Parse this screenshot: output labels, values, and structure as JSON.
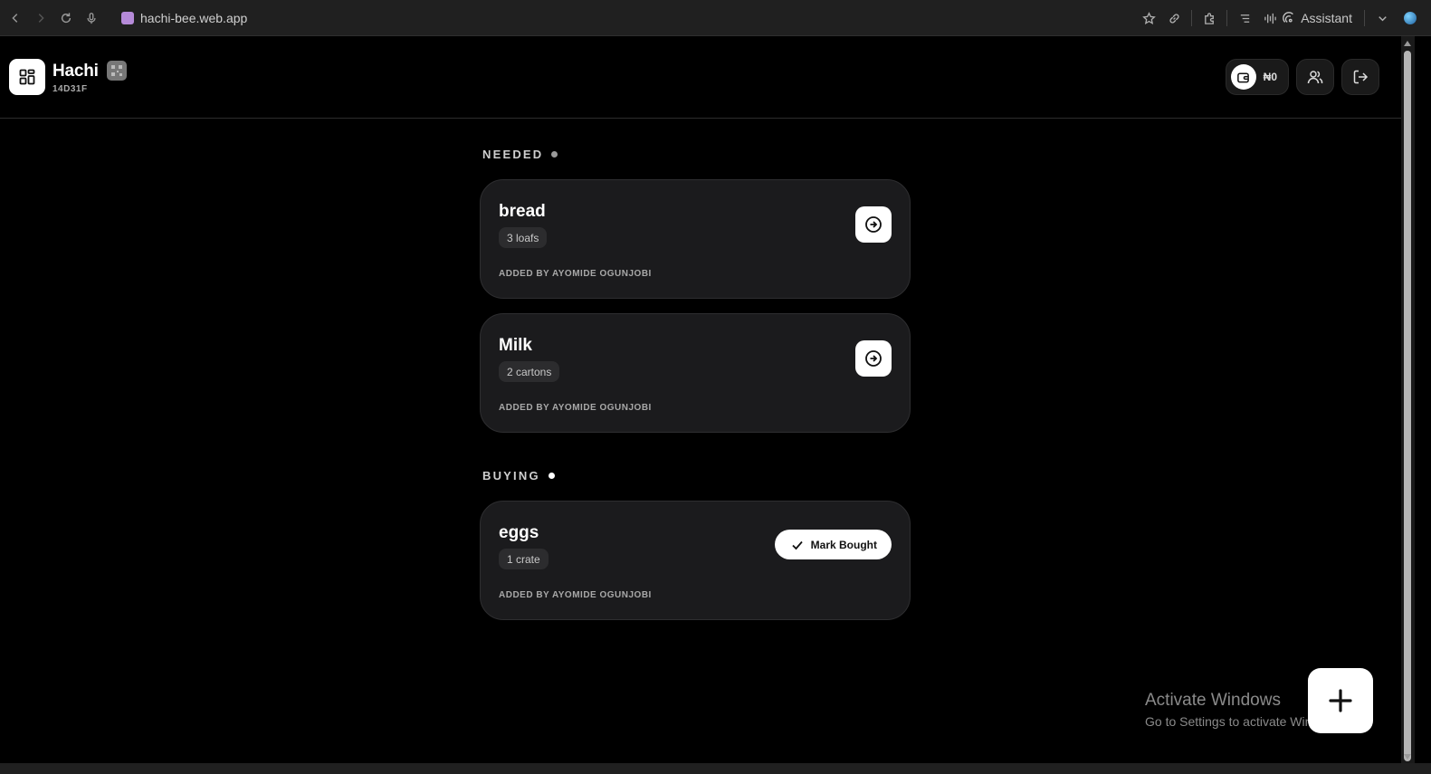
{
  "browser": {
    "url": "hachi-bee.web.app",
    "assistant_label": "Assistant"
  },
  "header": {
    "title": "Hachi",
    "code": "14D31F",
    "wallet_amount": "₦0"
  },
  "sections": {
    "needed": {
      "label": "NEEDED",
      "dot_color": "#9a9a9a",
      "items": [
        {
          "name": "bread",
          "quantity": "3 loafs",
          "added_by": "ADDED BY AYOMIDE OGUNJOBI"
        },
        {
          "name": "Milk",
          "quantity": "2 cartons",
          "added_by": "ADDED BY AYOMIDE OGUNJOBI"
        }
      ]
    },
    "buying": {
      "label": "BUYING",
      "dot_color": "#ffffff",
      "items": [
        {
          "name": "eggs",
          "quantity": "1 crate",
          "added_by": "ADDED BY AYOMIDE OGUNJOBI",
          "action_label": "Mark Bought"
        }
      ]
    }
  },
  "watermark": {
    "title": "Activate Windows",
    "subtitle": "Go to Settings to activate Windows."
  },
  "icons": {
    "add": "plus-icon",
    "item_action": "arrow-right-circle-icon",
    "mark_bought": "check-icon"
  }
}
